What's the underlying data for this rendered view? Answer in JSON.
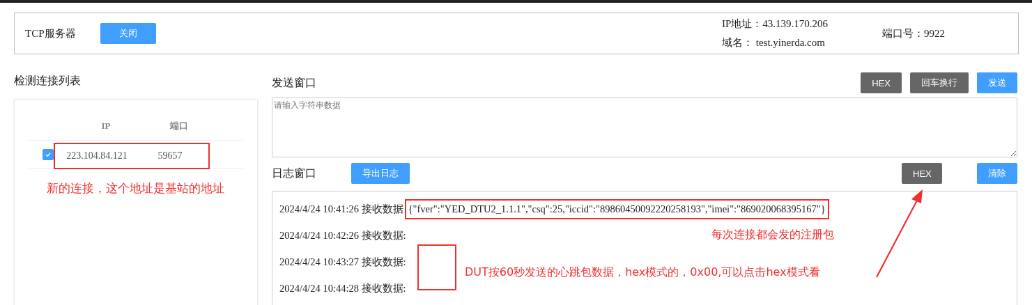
{
  "server": {
    "label": "TCP服务器",
    "toggle_button": "关闭",
    "ip_address": "IP地址：43.139.170.206",
    "domain": "域名： test.yinerda.com",
    "port": "端口号：9922"
  },
  "connections": {
    "title": "检测连接列表",
    "columns": [
      "IP",
      "端口"
    ],
    "rows": [
      {
        "selected": true,
        "ip": "223.104.84.121",
        "port": "59657"
      }
    ],
    "note": "新的连接，这个地址是基站的地址"
  },
  "send": {
    "title": "发送窗口",
    "buttons": [
      {
        "label": "HEX",
        "kind": "dark"
      },
      {
        "label": "回车换行",
        "kind": "dark"
      },
      {
        "label": "发送",
        "kind": "primary"
      }
    ],
    "placeholder": "请输入字符串数据"
  },
  "log": {
    "title": "日志窗口",
    "export_button": "导出日志",
    "hex_button": "HEX",
    "clear_button": "清除",
    "entries": [
      {
        "prefix": "2024/4/24 10:41:26 接收数据",
        "message": "{\"fver\":\"YED_DTU2_1.1.1\",\"csq\":25,\"iccid\":\"89860450092220258193\",\"imei\":\"869020068395167\"}"
      },
      {
        "prefix": "2024/4/24 10:42:26 接收数据:"
      },
      {
        "prefix": "2024/4/24 10:43:27 接收数据:"
      },
      {
        "prefix": "2024/4/24 10:44:28 接收数据:"
      }
    ],
    "register_note": "每次连接都会发的注册包",
    "heartbeat_note": "DUT按60秒发送的心跳包数据，hex模式的，0x00,可以点击hex模式看"
  }
}
